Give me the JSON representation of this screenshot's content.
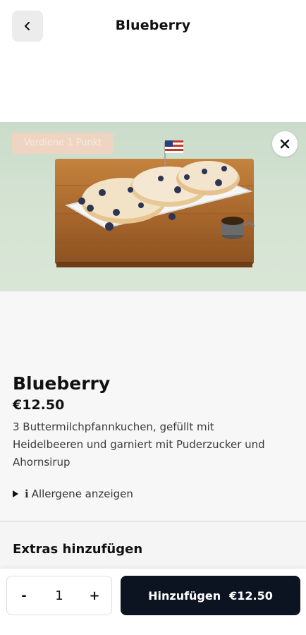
{
  "header": {
    "back_icon": "chevron-left-icon",
    "title": "Blueberry"
  },
  "hero": {
    "points_badge": "Verdiene 1 Punkt",
    "close_icon": "close-icon"
  },
  "product": {
    "name": "Blueberry",
    "price": "€12.50",
    "description": "3 Buttermilchpfannkuchen, gefüllt mit Heidelbeeren und garniert mit Puderzucker und Ahornsirup",
    "allergens_icon": "i",
    "allergens_label": "Allergene anzeigen"
  },
  "extras": {
    "title": "Extras hinzufügen"
  },
  "cart": {
    "decrement": "-",
    "quantity": "1",
    "increment": "+",
    "add_label": "Hinzufügen",
    "add_price": "€12.50"
  },
  "colors": {
    "primary_button": "#0d1421",
    "badge": "#f2d4c2",
    "hero_bg": "#cbdccb"
  }
}
